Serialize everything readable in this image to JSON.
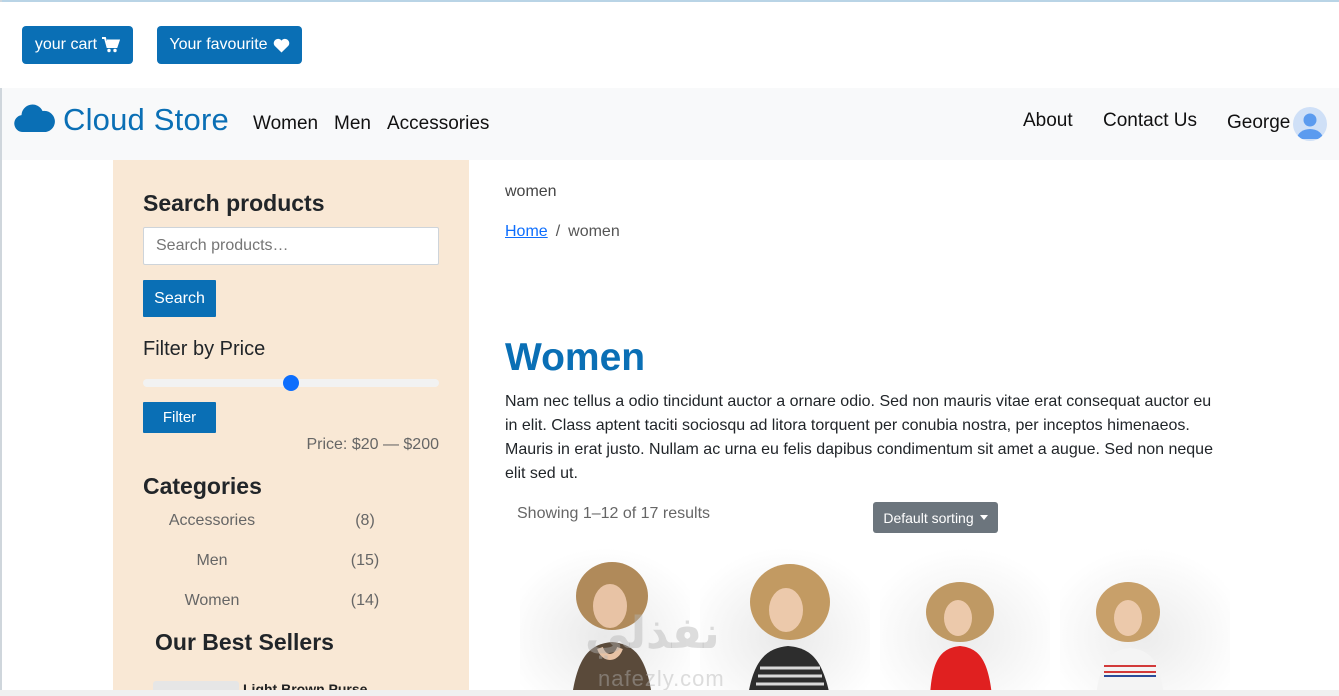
{
  "topbar": {
    "cart_label": "your cart",
    "cart_icon": "shopping-cart-icon",
    "fav_label": "Your favourite",
    "fav_icon": "heart-icon"
  },
  "navbar": {
    "brand": "Cloud Store",
    "brand_icon": "cloud-icon",
    "links_left": [
      "Women",
      "Men",
      "Accessories"
    ],
    "links_right": [
      "About",
      "Contact Us"
    ],
    "user_name": "George",
    "user_icon": "user-avatar-icon",
    "accent_color": "#0a6fb5"
  },
  "sidebar": {
    "search_heading": "Search products",
    "search_placeholder": "Search products…",
    "search_button": "Search",
    "filter_heading": "Filter by Price",
    "price_slider_fraction": 0.5,
    "filter_button": "Filter",
    "price_text": "Price: $20 — $200",
    "categories_heading": "Categories",
    "categories": [
      {
        "name": "Accessories",
        "count": "(8)"
      },
      {
        "name": "Men",
        "count": "(15)"
      },
      {
        "name": "Women",
        "count": "(14)"
      }
    ],
    "best_sellers_heading": "Our Best Sellers",
    "best_seller_first": "Light Brown Purse"
  },
  "main": {
    "category_label": "women",
    "breadcrumb": {
      "home": "Home",
      "separator": "/",
      "current": "women"
    },
    "title": "Women",
    "description": "Nam nec tellus a odio tincidunt auctor a ornare odio. Sed non mauris vitae erat consequat auctor eu in elit. Class aptent taciti sociosqu ad litora torquent per conubia nostra, per inceptos himenaeos. Mauris in erat justo. Nullam ac urna eu felis dapibus condimentum sit amet a augue. Sed non neque elit sed ut.",
    "results_count": "Showing 1–12 of 17 results",
    "sort_label": "Default sorting"
  },
  "watermark": {
    "text": "نفذلي",
    "sub": "nafezly.com"
  }
}
